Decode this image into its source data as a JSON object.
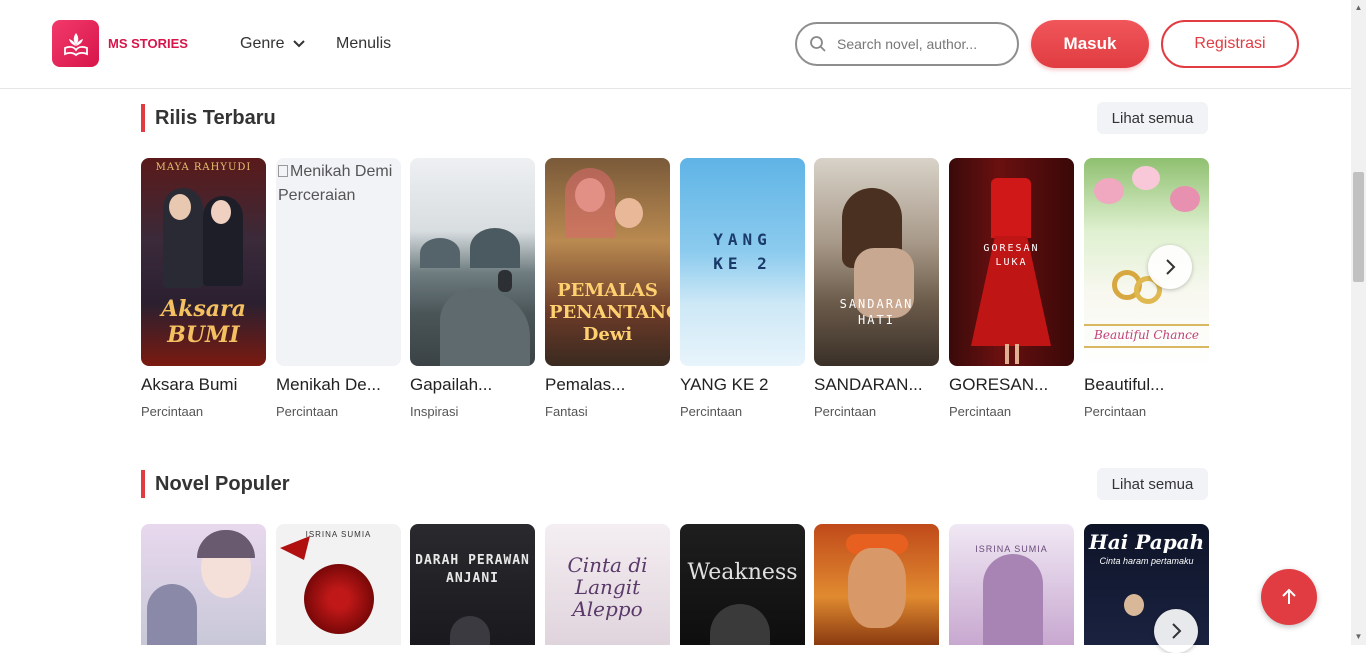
{
  "brand": {
    "name": "MS STORIES",
    "accent": "#e03c42"
  },
  "nav": {
    "genre": "Genre",
    "menulis": "Menulis"
  },
  "search": {
    "placeholder": "Search novel, author..."
  },
  "auth": {
    "login": "Masuk",
    "register": "Registrasi"
  },
  "sections": {
    "latest": {
      "title": "Rilis Terbaru",
      "see_all": "Lihat semua",
      "books": [
        {
          "title": "Aksara Bumi",
          "genre": "Percintaan",
          "cover_text": "Aksara BUMI",
          "cover_top": "MAYA RAHYUDI"
        },
        {
          "title": "Menikah De...",
          "genre": "Percintaan",
          "cover_alt": "Menikah Demi Perceraian"
        },
        {
          "title": "Gapailah...",
          "genre": "Inspirasi"
        },
        {
          "title": "Pemalas...",
          "genre": "Fantasi",
          "cover_text": "PEMALAS PENANTANG Dewi"
        },
        {
          "title": "YANG KE 2",
          "genre": "Percintaan",
          "cover_text": "YANG KE 2"
        },
        {
          "title": "SANDARAN...",
          "genre": "Percintaan",
          "cover_text": "SANDARAN HATI"
        },
        {
          "title": "GORESAN...",
          "genre": "Percintaan",
          "cover_text": "GORESAN LUKA"
        },
        {
          "title": "Beautiful...",
          "genre": "Percintaan",
          "cover_text": "Beautiful Chance"
        }
      ]
    },
    "popular": {
      "title": "Novel Populer",
      "see_all": "Lihat semua",
      "covers": [
        {
          "cover_text": ""
        },
        {
          "cover_text": "ISRINA SUMIA"
        },
        {
          "cover_text": "DARAH PERAWAN ANJANI"
        },
        {
          "cover_text": "Cinta di Langit Aleppo"
        },
        {
          "cover_text": "Weakness"
        },
        {
          "cover_text": ""
        },
        {
          "cover_text": "ISRINA SUMIA"
        },
        {
          "cover_text": "Hai Papah",
          "cover_sub": "Cinta haram pertamaku"
        }
      ]
    }
  }
}
